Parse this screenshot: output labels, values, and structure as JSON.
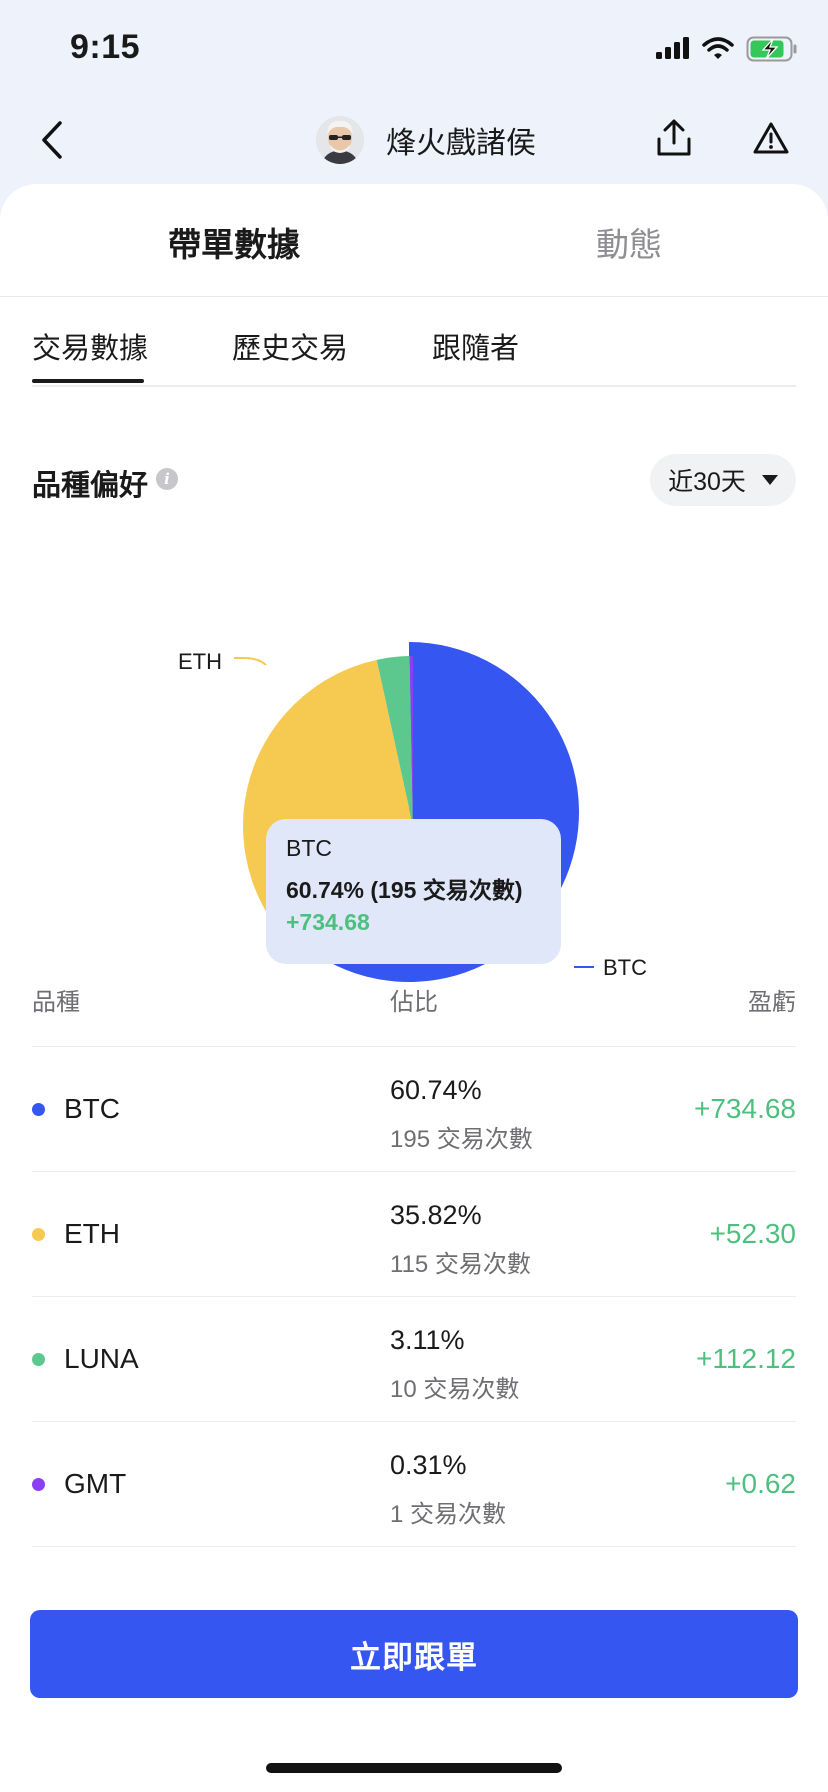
{
  "status_bar": {
    "time": "9:15",
    "icons": [
      "signal-icon",
      "wifi-icon",
      "battery-charging-icon"
    ]
  },
  "nav": {
    "icons": [
      "back-icon",
      "share-icon",
      "warning-icon"
    ],
    "trader_name": "烽火戲諸侯"
  },
  "top_tabs": {
    "active": "帶單數據",
    "inactive": "動態"
  },
  "sub_tabs": [
    "交易數據",
    "歷史交易",
    "跟隨者"
  ],
  "preference": {
    "title": "品種偏好",
    "info_icon": "i",
    "period": "近30天"
  },
  "chart_data": {
    "type": "pie",
    "slices": [
      {
        "name": "BTC",
        "value": 60.74,
        "color": "#3656f1"
      },
      {
        "name": "ETH",
        "value": 35.82,
        "color": "#f6c951"
      },
      {
        "name": "LUNA",
        "value": 3.11,
        "color": "#5cc88d"
      },
      {
        "name": "GMT",
        "value": 0.31,
        "color": "#8a3ff5"
      }
    ],
    "outer_labels": [
      "ETH",
      "BTC"
    ],
    "tooltip": {
      "name": "BTC",
      "main": "60.74% (195 交易次數)",
      "pnl": "+734.68"
    }
  },
  "table": {
    "headers": [
      "品種",
      "佔比",
      "盈虧"
    ],
    "rows": [
      {
        "symbol": "BTC",
        "color": "#3656f1",
        "percent": "60.74%",
        "trades": "195 交易次數",
        "pnl": "+734.68"
      },
      {
        "symbol": "ETH",
        "color": "#f6c951",
        "percent": "35.82%",
        "trades": "115 交易次數",
        "pnl": "+52.30"
      },
      {
        "symbol": "LUNA",
        "color": "#5cc88d",
        "percent": "3.11%",
        "trades": "10 交易次數",
        "pnl": "+112.12"
      },
      {
        "symbol": "GMT",
        "color": "#8a3ff5",
        "percent": "0.31%",
        "trades": "1 交易次數",
        "pnl": "+0.62"
      }
    ]
  },
  "cta": {
    "label": "立即跟單",
    "color": "#3656f1"
  },
  "profit_color": "#4fbf7f"
}
